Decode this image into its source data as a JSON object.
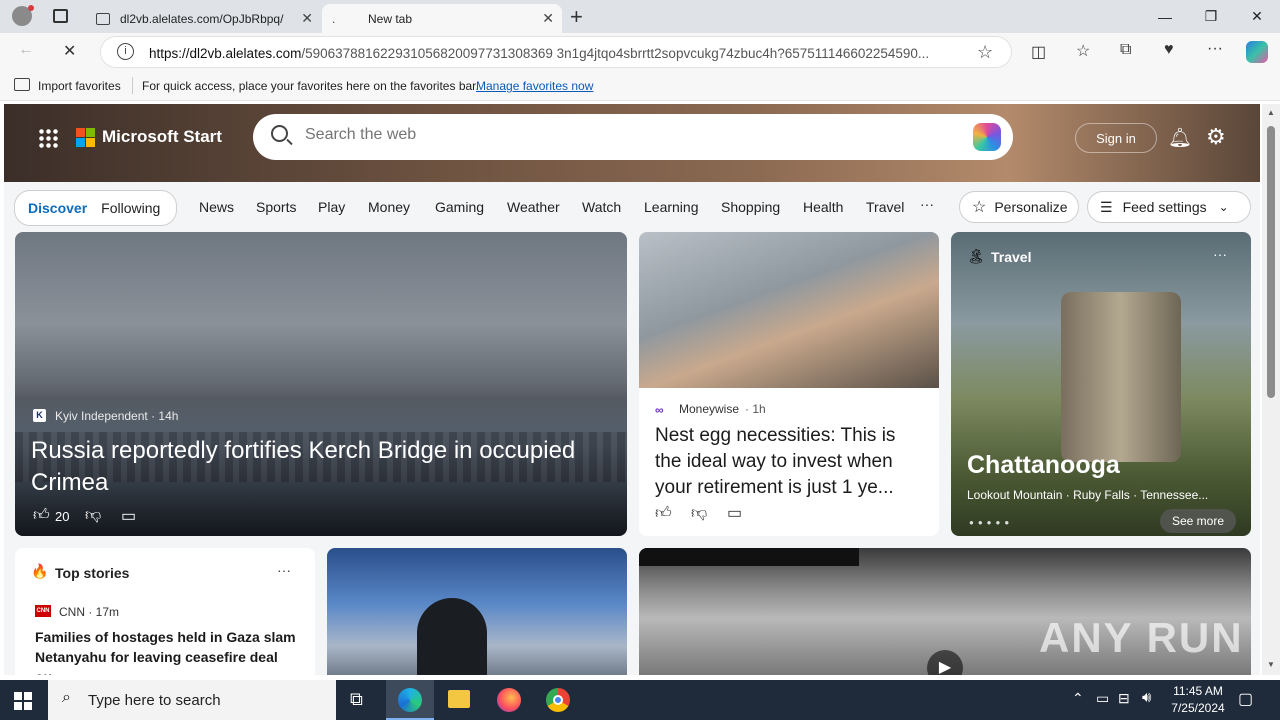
{
  "browser": {
    "tabs": [
      {
        "title": "dl2vb.alelates.com/OpJbRbpq/"
      },
      {
        "title": "New tab"
      }
    ],
    "url_host": "https://dl2vb.alelates.com",
    "url_path": "/590637881622931056820097731308369 3n1g4jtqo4sbrrtt2sopvcukg74zbuc4h?657511146602254590...",
    "favorites_bar": {
      "import_label": "Import favorites",
      "hint": "For quick access, place your favorites here on the favorites bar.",
      "manage_link": "Manage favorites now"
    }
  },
  "msn": {
    "brand": "Microsoft Start",
    "search_placeholder": "Search the web",
    "sign_in": "Sign in",
    "tabs": [
      "Discover",
      "Following"
    ],
    "categories": [
      "News",
      "Sports",
      "Play",
      "Money",
      "Gaming",
      "Weather",
      "Watch",
      "Learning",
      "Shopping",
      "Health",
      "Travel"
    ],
    "more": "···",
    "personalize": "Personalize",
    "feed_settings": "Feed settings"
  },
  "cards": {
    "main": {
      "source": "Kyiv Independent · 14h",
      "title": "Russia reportedly fortifies Kerch Bridge in occupied Crimea",
      "likes": "20"
    },
    "middle": {
      "source": "Moneywise",
      "time": "· 1h",
      "title": "Nest egg necessities: This is the ideal way to invest when your retirement is just 1 ye..."
    },
    "travel": {
      "label": "Travel",
      "title": "Chattanooga",
      "subtitle": "Lookout Mountain · Ruby Falls · Tennessee...",
      "see_more": "See more"
    },
    "top_stories": {
      "label": "Top stories",
      "source": "CNN · 17m",
      "headline": "Families of hostages held in Gaza slam Netanyahu for leaving ceasefire deal ou..."
    },
    "video_watermark": "ANY RUN"
  },
  "taskbar": {
    "search_placeholder": "Type here to search",
    "time": "11:45 AM",
    "date": "7/25/2024"
  }
}
